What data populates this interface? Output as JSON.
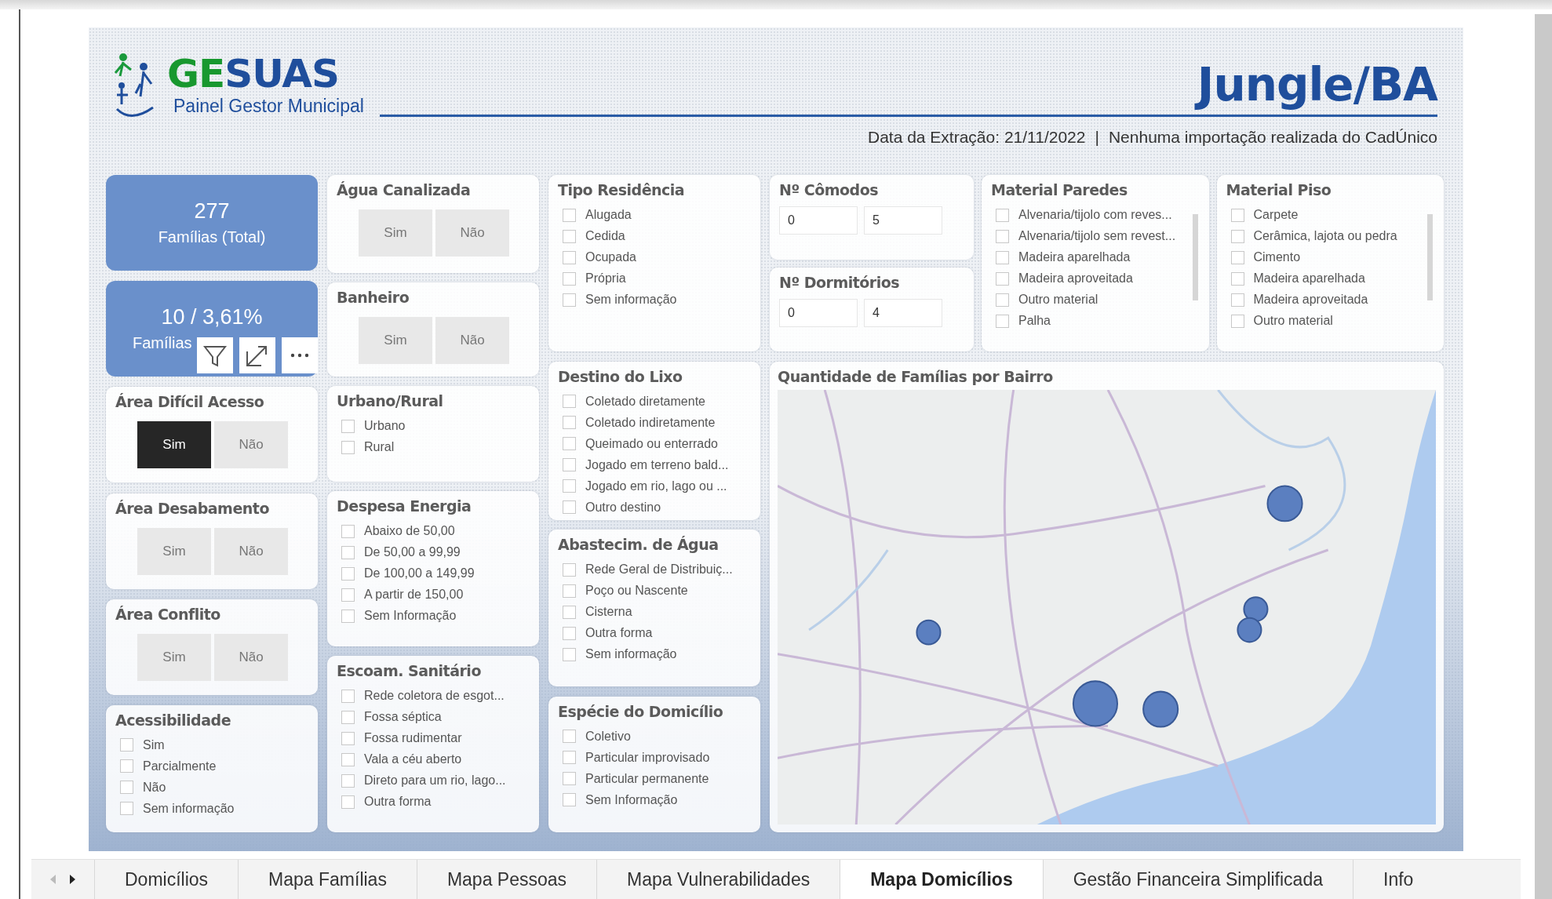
{
  "header": {
    "logo": {
      "brand_first": "GE",
      "brand_second": "SUAS",
      "subtitle": "Painel Gestor Municipal"
    },
    "title": "Jungle/BA",
    "extraction": "Data da Extração: 21/11/2022",
    "separator": "|",
    "import_note": "Nenhuma importação realizada do CadÚnico"
  },
  "columns": [
    [
      {
        "kind": "kpi",
        "value": "277",
        "label": "Famílias (Total)",
        "hovered": false
      },
      {
        "kind": "kpi",
        "value": "10 / 3,61%",
        "label": "Famílias",
        "hovered": true
      },
      {
        "kind": "toggle",
        "title": "Área Difícil Acesso",
        "options": [
          {
            "label": "Sim",
            "selected": true
          },
          {
            "label": "Não",
            "selected": false
          }
        ]
      },
      {
        "kind": "toggle",
        "title": "Área Desabamento",
        "options": [
          {
            "label": "Sim",
            "selected": false
          },
          {
            "label": "Não",
            "selected": false
          }
        ]
      },
      {
        "kind": "toggle",
        "title": "Área Conflito",
        "options": [
          {
            "label": "Sim",
            "selected": false
          },
          {
            "label": "Não",
            "selected": false
          }
        ]
      },
      {
        "kind": "checklist",
        "title": "Acessibilidade",
        "items": [
          {
            "label": "Sim",
            "checked": false
          },
          {
            "label": "Parcialmente",
            "checked": false
          },
          {
            "label": "Não",
            "checked": false
          },
          {
            "label": "Sem informação",
            "checked": false
          }
        ]
      }
    ],
    [
      {
        "kind": "toggle",
        "title": "Água Canalizada",
        "options": [
          {
            "label": "Sim",
            "selected": false
          },
          {
            "label": "Não",
            "selected": false
          }
        ]
      },
      {
        "kind": "toggle",
        "title": "Banheiro",
        "options": [
          {
            "label": "Sim",
            "selected": false
          },
          {
            "label": "Não",
            "selected": false
          }
        ]
      },
      {
        "kind": "checklist",
        "title": "Urbano/Rural",
        "items": [
          {
            "label": "Urbano",
            "checked": false
          },
          {
            "label": "Rural",
            "checked": false
          }
        ]
      },
      {
        "kind": "checklist",
        "title": "Despesa Energia",
        "items": [
          {
            "label": "Abaixo de 50,00",
            "checked": false
          },
          {
            "label": "De 50,00 a 99,99",
            "checked": false
          },
          {
            "label": "De 100,00 a 149,99",
            "checked": false
          },
          {
            "label": "A partir de 150,00",
            "checked": false
          },
          {
            "label": "Sem Informação",
            "checked": false
          }
        ]
      },
      {
        "kind": "checklist",
        "title": "Escoam. Sanitário",
        "items": [
          {
            "label": "Rede coletora de esgot...",
            "checked": false
          },
          {
            "label": "Fossa séptica",
            "checked": false
          },
          {
            "label": "Fossa rudimentar",
            "checked": false
          },
          {
            "label": "Vala a céu aberto",
            "checked": false
          },
          {
            "label": "Direto para um rio, lago...",
            "checked": false
          },
          {
            "label": "Outra forma",
            "checked": false
          }
        ]
      }
    ],
    [
      {
        "kind": "checklist",
        "title": "Tipo Residência",
        "items": [
          {
            "label": "Alugada",
            "checked": false
          },
          {
            "label": "Cedida",
            "checked": false
          },
          {
            "label": "Ocupada",
            "checked": false
          },
          {
            "label": "Própria",
            "checked": false
          },
          {
            "label": "Sem informação",
            "checked": false
          }
        ]
      },
      {
        "kind": "checklist",
        "title": "Destino do Lixo",
        "items": [
          {
            "label": "Coletado diretamente",
            "checked": false
          },
          {
            "label": "Coletado indiretamente",
            "checked": false
          },
          {
            "label": "Queimado ou enterrado",
            "checked": false
          },
          {
            "label": "Jogado em terreno bald...",
            "checked": false
          },
          {
            "label": "Jogado em rio, lago ou ...",
            "checked": false
          },
          {
            "label": "Outro destino",
            "checked": false
          }
        ]
      },
      {
        "kind": "checklist",
        "title": "Abastecim. de Água",
        "items": [
          {
            "label": "Rede Geral de Distribuiç...",
            "checked": false
          },
          {
            "label": "Poço ou Nascente",
            "checked": false
          },
          {
            "label": "Cisterna",
            "checked": false
          },
          {
            "label": "Outra forma",
            "checked": false
          },
          {
            "label": "Sem informação",
            "checked": false
          }
        ]
      },
      {
        "kind": "checklist",
        "title": "Espécie do Domicílio",
        "items": [
          {
            "label": "Coletivo",
            "checked": false
          },
          {
            "label": "Particular improvisado",
            "checked": false
          },
          {
            "label": "Particular permanente",
            "checked": false
          },
          {
            "label": "Sem Informação",
            "checked": false
          }
        ]
      }
    ]
  ],
  "right": {
    "ranges": [
      {
        "title": "Nº Cômodos",
        "min": "0",
        "max": "5"
      },
      {
        "title": "Nº Dormitórios",
        "min": "0",
        "max": "4"
      }
    ],
    "lists": [
      {
        "title": "Material Paredes",
        "items": [
          {
            "label": "Alvenaria/tijolo com reves...",
            "checked": false
          },
          {
            "label": "Alvenaria/tijolo sem revest...",
            "checked": false
          },
          {
            "label": "Madeira aparelhada",
            "checked": false
          },
          {
            "label": "Madeira aproveitada",
            "checked": false
          },
          {
            "label": "Outro material",
            "checked": false
          },
          {
            "label": "Palha",
            "checked": false
          }
        ]
      },
      {
        "title": "Material Piso",
        "items": [
          {
            "label": "Carpete",
            "checked": false
          },
          {
            "label": "Cerâmica, lajota ou pedra",
            "checked": false
          },
          {
            "label": "Cimento",
            "checked": false
          },
          {
            "label": "Madeira aparelhada",
            "checked": false
          },
          {
            "label": "Madeira aproveitada",
            "checked": false
          },
          {
            "label": "Outro material",
            "checked": false
          }
        ]
      }
    ],
    "map": {
      "title": "Quantidade de Famílias por Bairro"
    }
  },
  "tabs": [
    {
      "label": "Domicílios",
      "selected": false
    },
    {
      "label": "Mapa Famílias",
      "selected": false
    },
    {
      "label": "Mapa Pessoas",
      "selected": false
    },
    {
      "label": "Mapa Vulnerabilidades",
      "selected": false
    },
    {
      "label": "Mapa Domicílios",
      "selected": true
    },
    {
      "label": "Gestão Financeira Simplificada",
      "selected": false
    },
    {
      "label": "Info",
      "selected": false
    }
  ]
}
